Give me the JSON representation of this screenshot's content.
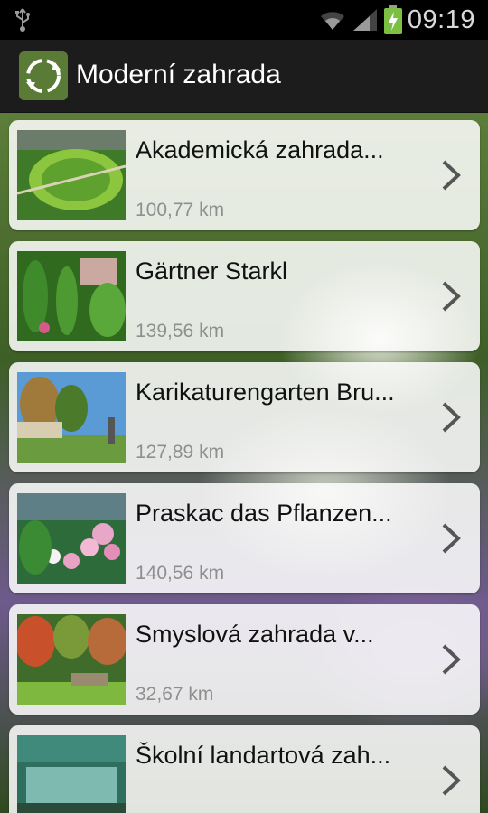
{
  "status_bar": {
    "time": "09:19",
    "icons": [
      "usb-icon",
      "wifi-icon",
      "signal-icon",
      "battery-charging-icon"
    ]
  },
  "action_bar": {
    "title": "Moderní zahrada",
    "app_icon": "recycle-garden-icon"
  },
  "list": {
    "items": [
      {
        "title": "Akademická zahrada...",
        "distance": "100,77 km"
      },
      {
        "title": "Gärtner Starkl",
        "distance": "139,56 km"
      },
      {
        "title": "Karikaturengarten Bru...",
        "distance": "127,89 km"
      },
      {
        "title": "Praskac das Pflanzen...",
        "distance": "140,56 km"
      },
      {
        "title": "Smyslová zahrada v...",
        "distance": "32,67 km"
      },
      {
        "title": "Školní landartová zah...",
        "distance": ""
      }
    ]
  },
  "colors": {
    "status_bar_bg": "#000000",
    "action_bar_bg": "#1c1c1c",
    "card_bg": "#ffffff",
    "distance_text": "#8f8f8f",
    "chevron": "#555555"
  }
}
